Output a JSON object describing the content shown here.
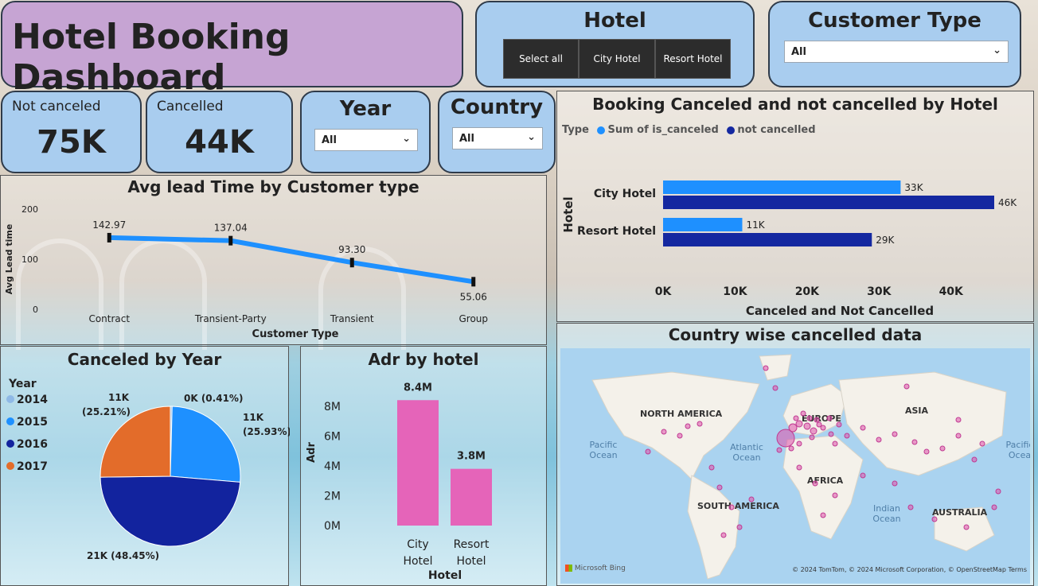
{
  "dashboard_title": "Hotel Booking Dashboard",
  "hotel_slicer": {
    "title": "Hotel",
    "options": [
      "Select all",
      "City Hotel",
      "Resort Hotel"
    ]
  },
  "customer_type_slicer": {
    "title": "Customer Type",
    "value": "All"
  },
  "year_slicer": {
    "title": "Year",
    "value": "All"
  },
  "country_slicer": {
    "title": "Country",
    "value": "All"
  },
  "kpis": {
    "not_canceled": {
      "label": "Not canceled",
      "value": "75K"
    },
    "cancelled": {
      "label": "Cancelled",
      "value": "44K"
    }
  },
  "colors": {
    "light_blue": "#1e90ff",
    "dark_blue": "#1428a0",
    "pink": "#e564b9",
    "orange": "#e36c2a",
    "navy": "#12239e"
  },
  "chart_data": [
    {
      "id": "lead_time",
      "type": "line",
      "title": "Avg lead Time by Customer type",
      "xlabel": "Customer Type",
      "ylabel": "Avg Lead time",
      "yticks": [
        "0",
        "100",
        "200"
      ],
      "ylim": [
        0,
        200
      ],
      "categories": [
        "Contract",
        "Transient-Party",
        "Transient",
        "Group"
      ],
      "values": [
        142.97,
        137.04,
        93.3,
        55.06
      ],
      "labels": [
        "142.97",
        "137.04",
        "93.30",
        "55.06"
      ]
    },
    {
      "id": "cancel_by_hotel",
      "type": "bar",
      "title": "Booking Canceled and not cancelled by Hotel",
      "legend_title": "Type",
      "xlabel": "Canceled and Not Cancelled",
      "ylabel": "Hotel",
      "xticks": [
        "0K",
        "10K",
        "20K",
        "30K",
        "40K"
      ],
      "xlim": [
        0,
        46000
      ],
      "categories": [
        "City Hotel",
        "Resort Hotel"
      ],
      "series": [
        {
          "name": "Sum of is_canceled",
          "values": [
            33000,
            11000
          ],
          "labels": [
            "33K",
            "11K"
          ]
        },
        {
          "name": "not cancelled",
          "values": [
            46000,
            29000
          ],
          "labels": [
            "46K",
            "29K"
          ]
        }
      ]
    },
    {
      "id": "canceled_by_year",
      "type": "pie",
      "title": "Canceled by Year",
      "legend_title": "Year",
      "categories": [
        "2014",
        "2015",
        "2016",
        "2017"
      ],
      "values": [
        0.41,
        25.93,
        48.45,
        25.21
      ],
      "labels": [
        "0K (0.41%)",
        "11K (25.93%)",
        "21K (48.45%)",
        "11K (25.21%)"
      ]
    },
    {
      "id": "adr_by_hotel",
      "type": "bar",
      "title": "Adr by hotel",
      "xlabel": "Hotel",
      "ylabel": "Adr",
      "yticks": [
        "0M",
        "2M",
        "4M",
        "6M",
        "8M"
      ],
      "ylim": [
        0,
        9000000
      ],
      "categories": [
        "City Hotel",
        "Resort Hotel"
      ],
      "values": [
        8400000,
        3800000
      ],
      "labels": [
        "8.4M",
        "3.8M"
      ]
    }
  ],
  "map": {
    "title": "Country wise cancelled data",
    "labels": [
      "NORTH AMERICA",
      "EUROPE",
      "ASIA",
      "AFRICA",
      "SOUTH AMERICA",
      "AUSTRALIA"
    ],
    "oceans": [
      "Pacific Ocean",
      "Atlantic Ocean",
      "Indian Ocean",
      "Pacific Ocea"
    ],
    "attribution": "© 2024 TomTom, © 2024 Microsoft Corporation, © OpenStreetMap  Terms",
    "brand": "Microsoft Bing"
  }
}
